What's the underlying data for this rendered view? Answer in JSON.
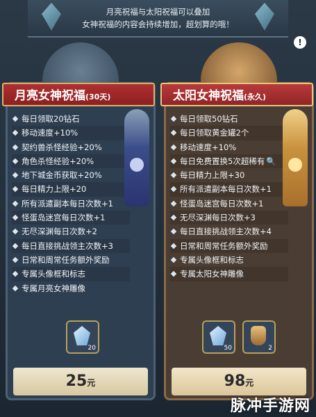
{
  "banner": {
    "line1": "月亮祝福与太阳祝福可以叠加",
    "line2": "女神祝福的内容会持续增加，超划算的哦！"
  },
  "help_symbol": "!",
  "moon": {
    "title": "月亮女神祝福",
    "duration": "(30天)",
    "rows": [
      "每日领取20钻石",
      "移动速度+10%",
      "契约兽杀怪经验+20%",
      "角色杀怪经验+20%",
      "地下城金币获取+20%",
      "每日精力上限+20",
      "所有派遣副本每日次数+1",
      "怪蛋岛迷宫每日次数+1",
      "无尽深渊每日次数+2",
      "每日直接挑战领主次数+3",
      "日常和周常任务额外奖励",
      "专属头像框和标志",
      "专属月亮女神雕像"
    ],
    "items": [
      {
        "icon": "crystal-icon",
        "count": "20"
      }
    ],
    "price": "25",
    "price_unit": "元"
  },
  "sun": {
    "title": "太阳女神祝福",
    "duration": "(永久)",
    "rows": [
      "每日领取50钻石",
      "每日领取黄金罐2个",
      "移动速度+10%",
      "每日免费置换5次超稀有",
      "每日精力上限+30",
      "所有派遣副本每日次数+1",
      "怪蛋岛迷宫每日次数+1",
      "无尽深渊每日次数+3",
      "每日直接挑战领主次数+4",
      "日常和周常任务额外奖励",
      "专属头像框和标志",
      "专属太阳女神雕像"
    ],
    "items": [
      {
        "icon": "crystal-icon",
        "count": "50"
      },
      {
        "icon": "golden-jar-icon",
        "count": "2"
      }
    ],
    "price": "98",
    "price_unit": "元"
  },
  "watermark": "脉冲手游网"
}
